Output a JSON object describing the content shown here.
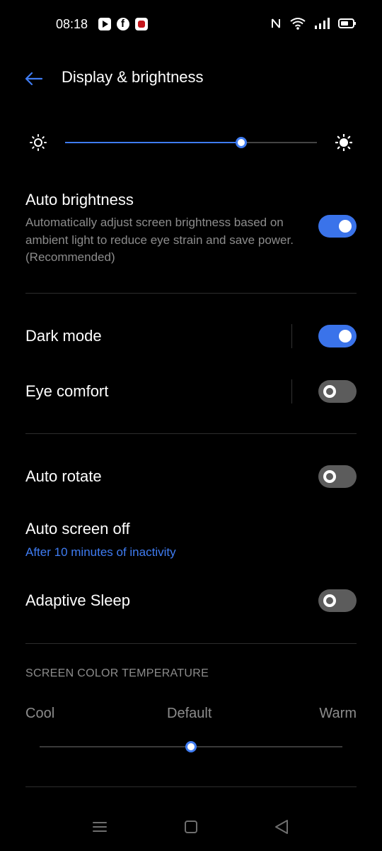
{
  "status_bar": {
    "time": "08:18",
    "notification_icons": [
      "youtube-icon",
      "facebook-icon",
      "app-notification-icon"
    ],
    "system_icons": [
      "nfc-icon",
      "wifi-icon",
      "signal-icon",
      "battery-icon"
    ]
  },
  "header": {
    "back_icon": "back-arrow-icon",
    "title": "Display & brightness"
  },
  "brightness": {
    "level": 0.7,
    "min_icon": "sun-dim-icon",
    "max_icon": "sun-bright-icon"
  },
  "auto_brightness": {
    "title": "Auto brightness",
    "description": "Automatically adjust screen brightness based on ambient light to reduce eye strain and save power. (Recommended)",
    "enabled": true
  },
  "dark_mode": {
    "title": "Dark mode",
    "enabled": true
  },
  "eye_comfort": {
    "title": "Eye comfort",
    "enabled": false
  },
  "auto_rotate": {
    "title": "Auto rotate",
    "enabled": false
  },
  "auto_screen_off": {
    "title": "Auto screen off",
    "value": "After 10 minutes of inactivity"
  },
  "adaptive_sleep": {
    "title": "Adaptive Sleep",
    "enabled": false
  },
  "color_temperature": {
    "section_title": "SCREEN COLOR TEMPERATURE",
    "cool_label": "Cool",
    "default_label": "Default",
    "warm_label": "Warm",
    "level": 0.5
  },
  "navigation": {
    "icons": [
      "menu-icon",
      "home-icon",
      "back-icon"
    ]
  },
  "colors": {
    "accent": "#3f7cf2",
    "background": "#000000",
    "secondary_text": "#8c8c8c"
  }
}
